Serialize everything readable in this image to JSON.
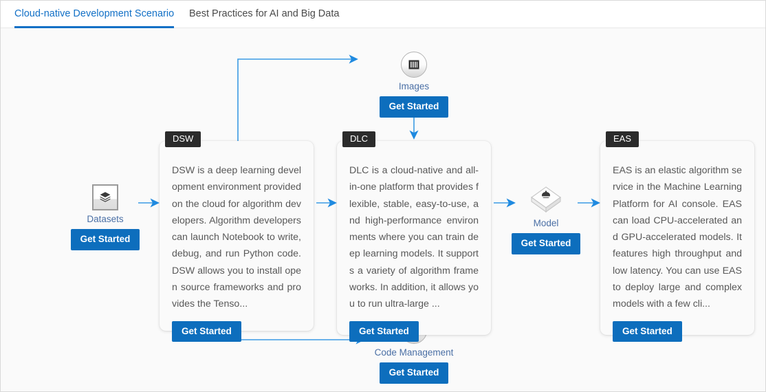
{
  "tabs": [
    {
      "label": "Cloud-native Development Scenario",
      "active": true
    },
    {
      "label": "Best Practices for AI and Big Data",
      "active": false
    }
  ],
  "colors": {
    "accent": "#1270c6",
    "button": "#0d6ebd",
    "edge": "#1f8ae0",
    "badge_bg": "#2b2b2b",
    "canvas_bg": "#fafafa",
    "node_label": "#4a6fa5",
    "body_text": "#585858"
  },
  "common": {
    "get_started": "Get Started"
  },
  "cards": [
    {
      "id": "dsw",
      "title": "DSW",
      "description": "DSW is a deep learning development environment provided on the cloud for algorithm developers. Algorithm developers can launch Notebook to write, debug, and run Python code. DSW allows you to install open source frameworks and provides the Tenso...",
      "button": "Get Started"
    },
    {
      "id": "dlc",
      "title": "DLC",
      "description": "DLC is a cloud-native and all-in-one platform that provides flexible, stable, easy-to-use, and high-performance environments where you can train deep learning models. It supports a variety of algorithm frameworks. In addition, it allows you to run ultra-large ...",
      "button": "Get Started"
    },
    {
      "id": "eas",
      "title": "EAS",
      "description": "EAS is an elastic algorithm service in the Machine Learning Platform for AI console. EAS can load CPU-accelerated and GPU-accelerated models. It features high throughput and low latency. You can use EAS to deploy large and complex models with a few cli...",
      "button": "Get Started"
    }
  ],
  "nodes": [
    {
      "id": "datasets",
      "label": "Datasets",
      "icon": "datasets-stack-icon",
      "button": "Get Started"
    },
    {
      "id": "images",
      "label": "Images",
      "icon": "images-container-icon",
      "button": "Get Started"
    },
    {
      "id": "model",
      "label": "Model",
      "icon": "model-cube-icon",
      "button": "Get Started"
    },
    {
      "id": "code",
      "label": "Code Management",
      "icon": "code-monitor-icon",
      "button": "Get Started"
    }
  ],
  "edges": [
    {
      "from": "datasets",
      "to": "dsw",
      "type": "arrow-right"
    },
    {
      "from": "dsw",
      "to": "dlc",
      "type": "arrow-right"
    },
    {
      "from": "dlc",
      "to": "model",
      "type": "arrow-right"
    },
    {
      "from": "model",
      "to": "eas",
      "type": "arrow-right"
    },
    {
      "from": "images",
      "to": "dlc",
      "type": "arrow-down"
    },
    {
      "from": "code",
      "to": "dlc",
      "type": "arrow-up"
    },
    {
      "from": "dsw",
      "to": "images",
      "type": "elbow-up-right"
    },
    {
      "from": "dsw",
      "to": "code",
      "type": "elbow-down-right"
    }
  ]
}
